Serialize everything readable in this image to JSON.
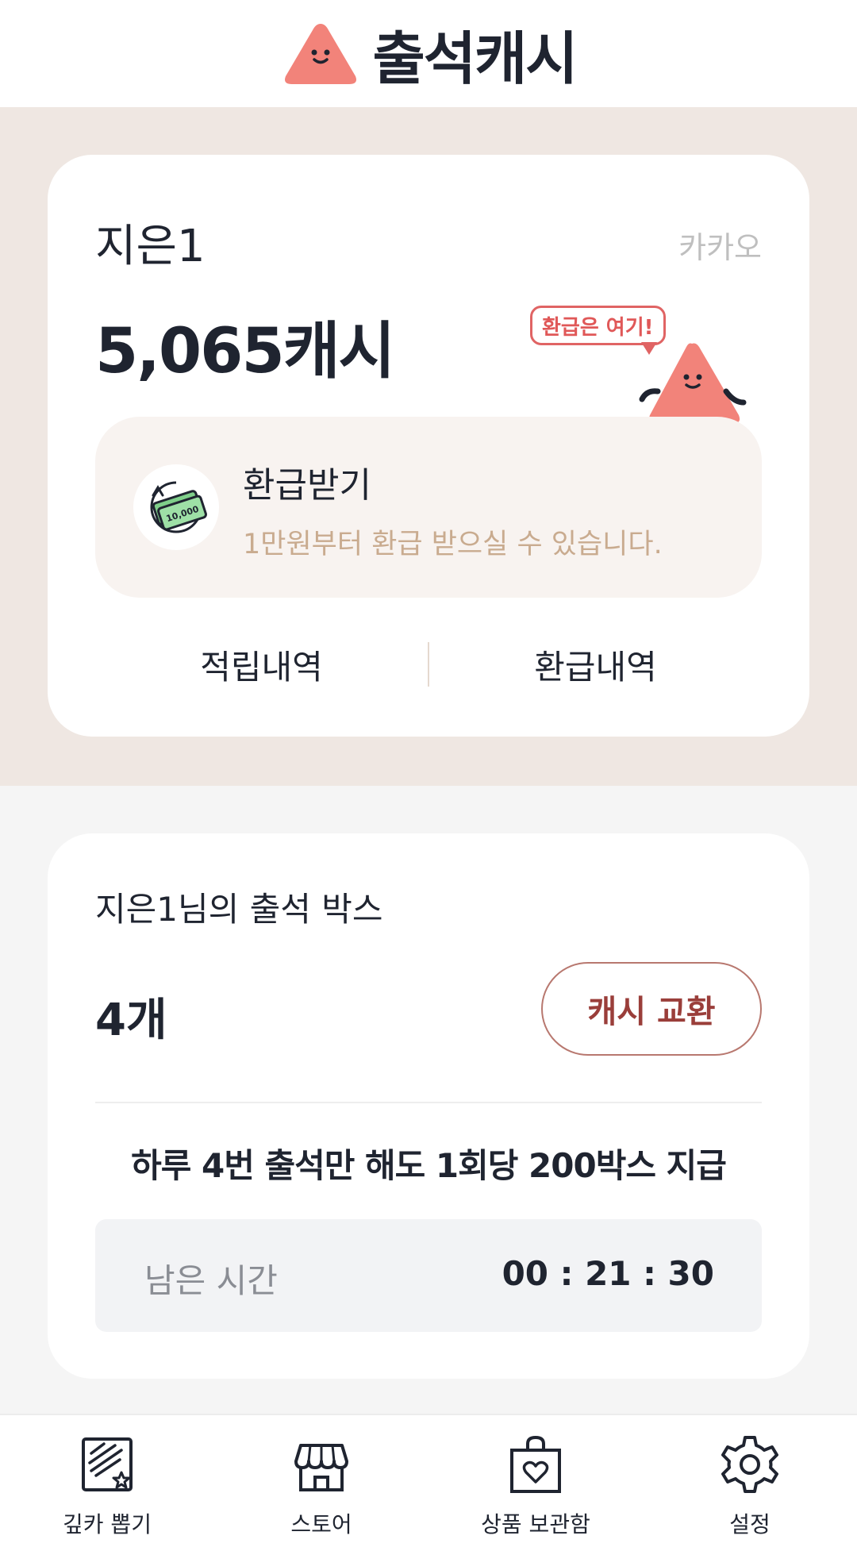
{
  "header": {
    "app_title": "출석캐시",
    "logo_icon": "triangle-mascot-logo"
  },
  "account": {
    "user_name": "지은1",
    "login_type": "카카오",
    "cash_amount": "5,065캐시",
    "refund_bubble": "환급은 여기!"
  },
  "refund": {
    "title": "환급받기",
    "description": "1만원부터 환급 받으실 수 있습니다.",
    "icon_label": "10,000"
  },
  "history": {
    "earn_label": "적립내역",
    "refund_label": "환급내역"
  },
  "attendance": {
    "title": "지은1님의 출석 박스",
    "count": "4개",
    "exchange_button": "캐시 교환",
    "promo": "하루 4번 출석만 해도 1회당 200박스 지급",
    "remaining_label": "남은 시간",
    "remaining_time": "00 : 21 : 30"
  },
  "nav": {
    "items": [
      {
        "label": "깊카 뽑기",
        "icon": "scratch-card-icon"
      },
      {
        "label": "스토어",
        "icon": "store-icon"
      },
      {
        "label": "상품 보관함",
        "icon": "gift-bag-icon"
      },
      {
        "label": "설정",
        "icon": "gear-icon"
      }
    ]
  },
  "colors": {
    "brand_coral": "#f2837a",
    "beige_bg": "#efe7e2",
    "accent_red": "#9a3e3a",
    "muted_tan": "#c9ab8f"
  }
}
